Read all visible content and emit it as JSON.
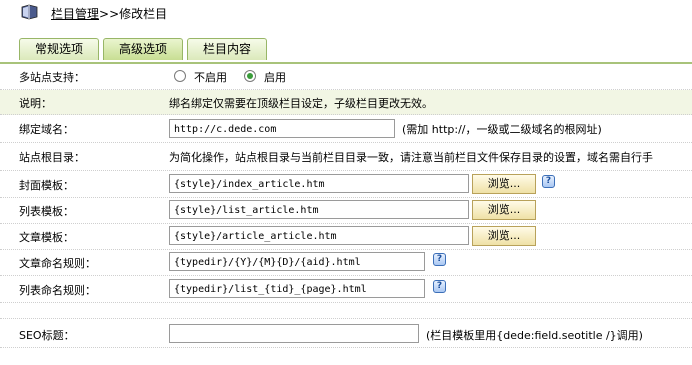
{
  "header": {
    "crumb_link": "栏目管理",
    "crumb_rest": ">>修改栏目"
  },
  "tabs": [
    {
      "label": "常规选项",
      "active": false
    },
    {
      "label": "高级选项",
      "active": true
    },
    {
      "label": "栏目内容",
      "active": false
    }
  ],
  "form": {
    "multisite": {
      "label": "多站点支持：",
      "options": [
        "不启用",
        "启用"
      ],
      "selected": "启用"
    },
    "description": {
      "label": "说明：",
      "text": "绑名绑定仅需要在顶级栏目设定，子级栏目更改无效。"
    },
    "domain": {
      "label": "绑定域名：",
      "value": "http://c.dede.com",
      "hint": "(需加 http://，一级或二级域名的根网址)"
    },
    "site_root": {
      "label": "站点根目录：",
      "text": "为简化操作，站点根目录与当前栏目目录一致，请注意当前栏目文件保存目录的设置，域名需自行手"
    },
    "cover_template": {
      "label": "封面模板：",
      "value": "{style}/index_article.htm",
      "button": "浏览..."
    },
    "list_template": {
      "label": "列表模板：",
      "value": "{style}/list_article.htm",
      "button": "浏览..."
    },
    "article_template": {
      "label": "文章模板：",
      "value": "{style}/article_article.htm",
      "button": "浏览..."
    },
    "article_naming": {
      "label": "文章命名规则：",
      "value": "{typedir}/{Y}/{M}{D}/{aid}.html"
    },
    "list_naming": {
      "label": "列表命名规则：",
      "value": "{typedir}/list_{tid}_{page}.html"
    },
    "seo_title": {
      "label": "SEO标题：",
      "value": "",
      "hint": "(栏目模板里用{dede:field.seotitle /}调用)"
    }
  },
  "icons": {
    "help_glyph": "?"
  }
}
